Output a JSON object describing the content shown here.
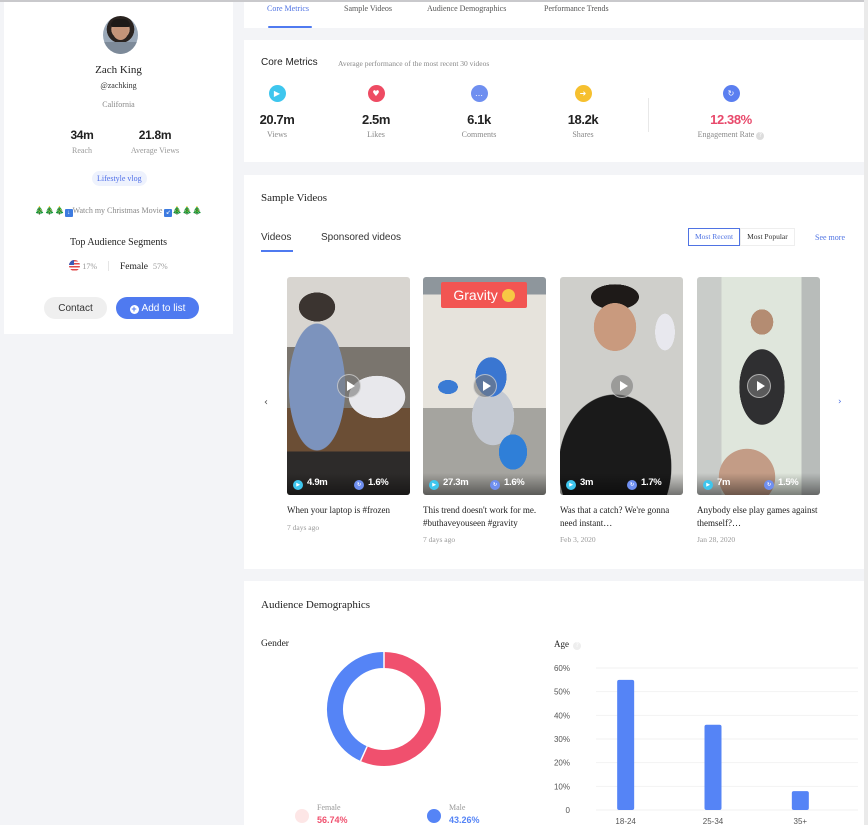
{
  "profile": {
    "name": "Zach King",
    "handle": "@zachking",
    "location": "California",
    "stats": [
      {
        "value": "34m",
        "label": "Reach"
      },
      {
        "value": "21.8m",
        "label": "Average Views"
      }
    ],
    "tag": "Lifestyle vlog",
    "bio_prefix": "🎄🎄🎄",
    "bio_text": "Watch my Christmas Movie",
    "bio_suffix": "🎄🎄🎄",
    "segments_title": "Top Audience Segments",
    "segment_country_pct": "17%",
    "segment_gender": "Female",
    "segment_gender_pct": "57%",
    "contact_label": "Contact",
    "add_label": "Add to list"
  },
  "tabs": [
    {
      "label": "Core Metrics",
      "active": true
    },
    {
      "label": "Sample Videos",
      "active": false
    },
    {
      "label": "Audience Demographics",
      "active": false
    },
    {
      "label": "Performance Trends",
      "active": false
    }
  ],
  "core_metrics": {
    "title": "Core Metrics",
    "subtitle": "Average performance of the most recent 30 videos",
    "items": [
      {
        "icon": "play-icon",
        "value": "20.7m",
        "label": "Views",
        "color": "#3ec6ee"
      },
      {
        "icon": "heart-icon",
        "value": "2.5m",
        "label": "Likes",
        "color": "#ee4b63"
      },
      {
        "icon": "comment-icon",
        "value": "6.1k",
        "label": "Comments",
        "color": "#6f8ff0"
      },
      {
        "icon": "share-icon",
        "value": "18.2k",
        "label": "Shares",
        "color": "#f6c02f"
      }
    ],
    "engagement": {
      "icon": "refresh-icon",
      "value": "12.38%",
      "label": "Engagement Rate",
      "color": "#5b7ff0",
      "value_color": "#e8496b"
    }
  },
  "sample_videos": {
    "title": "Sample Videos",
    "tabs": [
      "Videos",
      "Sponsored videos"
    ],
    "sort_options": [
      "Most Recent",
      "Most Popular"
    ],
    "sort_selected": "Most Recent",
    "see_more": "See more",
    "videos": [
      {
        "views": "4.9m",
        "engagement": "1.6%",
        "caption": "When your laptop is #frozen",
        "date": "7 days ago"
      },
      {
        "views": "27.3m",
        "engagement": "1.6%",
        "caption": "This trend doesn't work for me. #buthaveyouseen #gravity",
        "date": "7 days ago",
        "overlay_text": "Gravity"
      },
      {
        "views": "3m",
        "engagement": "1.7%",
        "caption": "Was that a catch? We're gonna need instant…",
        "date": "Feb 3, 2020"
      },
      {
        "views": "7m",
        "engagement": "1.5%",
        "caption": "Anybody else play games against themself?…",
        "date": "Jan 28, 2020"
      }
    ]
  },
  "demographics": {
    "title": "Audience Demographics",
    "gender_title": "Gender",
    "age_title": "Age",
    "gender_legend": [
      {
        "label": "Female",
        "value": "56.74%",
        "color": "#f0506e"
      },
      {
        "label": "Male",
        "value": "43.26%",
        "color": "#5584f6"
      }
    ]
  },
  "chart_data": [
    {
      "type": "pie",
      "title": "Gender",
      "categories": [
        "Female",
        "Male"
      ],
      "values": [
        56.74,
        43.26
      ],
      "colors": [
        "#f0506e",
        "#5584f6"
      ],
      "donut": true
    },
    {
      "type": "bar",
      "title": "Age",
      "categories": [
        "18-24",
        "25-34",
        "35+"
      ],
      "values": [
        55,
        36,
        8
      ],
      "ylim": [
        0,
        60
      ],
      "yticks": [
        "0",
        "10%",
        "20%",
        "30%",
        "40%",
        "50%",
        "60%"
      ],
      "xlabel": "",
      "ylabel": "",
      "color": "#5584f6",
      "grid": true
    }
  ]
}
